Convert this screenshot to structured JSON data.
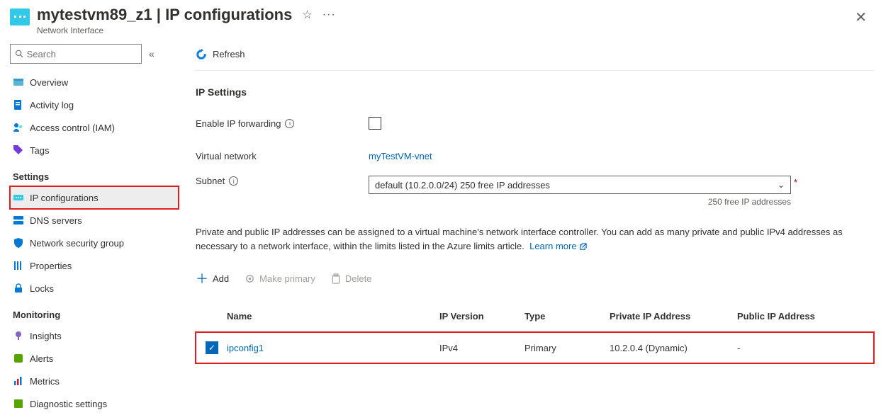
{
  "header": {
    "resource_name": "mytestvm89_z1",
    "page_name": "IP configurations",
    "subtitle": "Network Interface"
  },
  "sidebar": {
    "search_placeholder": "Search",
    "items_top": [
      {
        "label": "Overview"
      },
      {
        "label": "Activity log"
      },
      {
        "label": "Access control (IAM)"
      },
      {
        "label": "Tags"
      }
    ],
    "group_settings": "Settings",
    "items_settings": [
      {
        "label": "IP configurations"
      },
      {
        "label": "DNS servers"
      },
      {
        "label": "Network security group"
      },
      {
        "label": "Properties"
      },
      {
        "label": "Locks"
      }
    ],
    "group_monitoring": "Monitoring",
    "items_monitoring": [
      {
        "label": "Insights"
      },
      {
        "label": "Alerts"
      },
      {
        "label": "Metrics"
      },
      {
        "label": "Diagnostic settings"
      }
    ]
  },
  "toolbar": {
    "refresh": "Refresh"
  },
  "ip_settings": {
    "title": "IP Settings",
    "enable_forwarding_label": "Enable IP forwarding",
    "virtual_network_label": "Virtual network",
    "virtual_network_value": "myTestVM-vnet",
    "subnet_label": "Subnet",
    "subnet_value": "default (10.2.0.0/24) 250 free IP addresses",
    "subnet_hint": "250 free IP addresses"
  },
  "description": {
    "text": "Private and public IP addresses can be assigned to a virtual machine's network interface controller. You can add as many private and public IPv4 addresses as necessary to a network interface, within the limits listed in the Azure limits article.",
    "learn_more": "Learn more"
  },
  "cmdbar": {
    "add": "Add",
    "make_primary": "Make primary",
    "delete": "Delete"
  },
  "table": {
    "headers": {
      "name": "Name",
      "ipver": "IP Version",
      "type": "Type",
      "priv": "Private IP Address",
      "pub": "Public IP Address"
    },
    "rows": [
      {
        "name": "ipconfig1",
        "ipver": "IPv4",
        "type": "Primary",
        "priv": "10.2.0.4 (Dynamic)",
        "pub": "-"
      }
    ]
  }
}
